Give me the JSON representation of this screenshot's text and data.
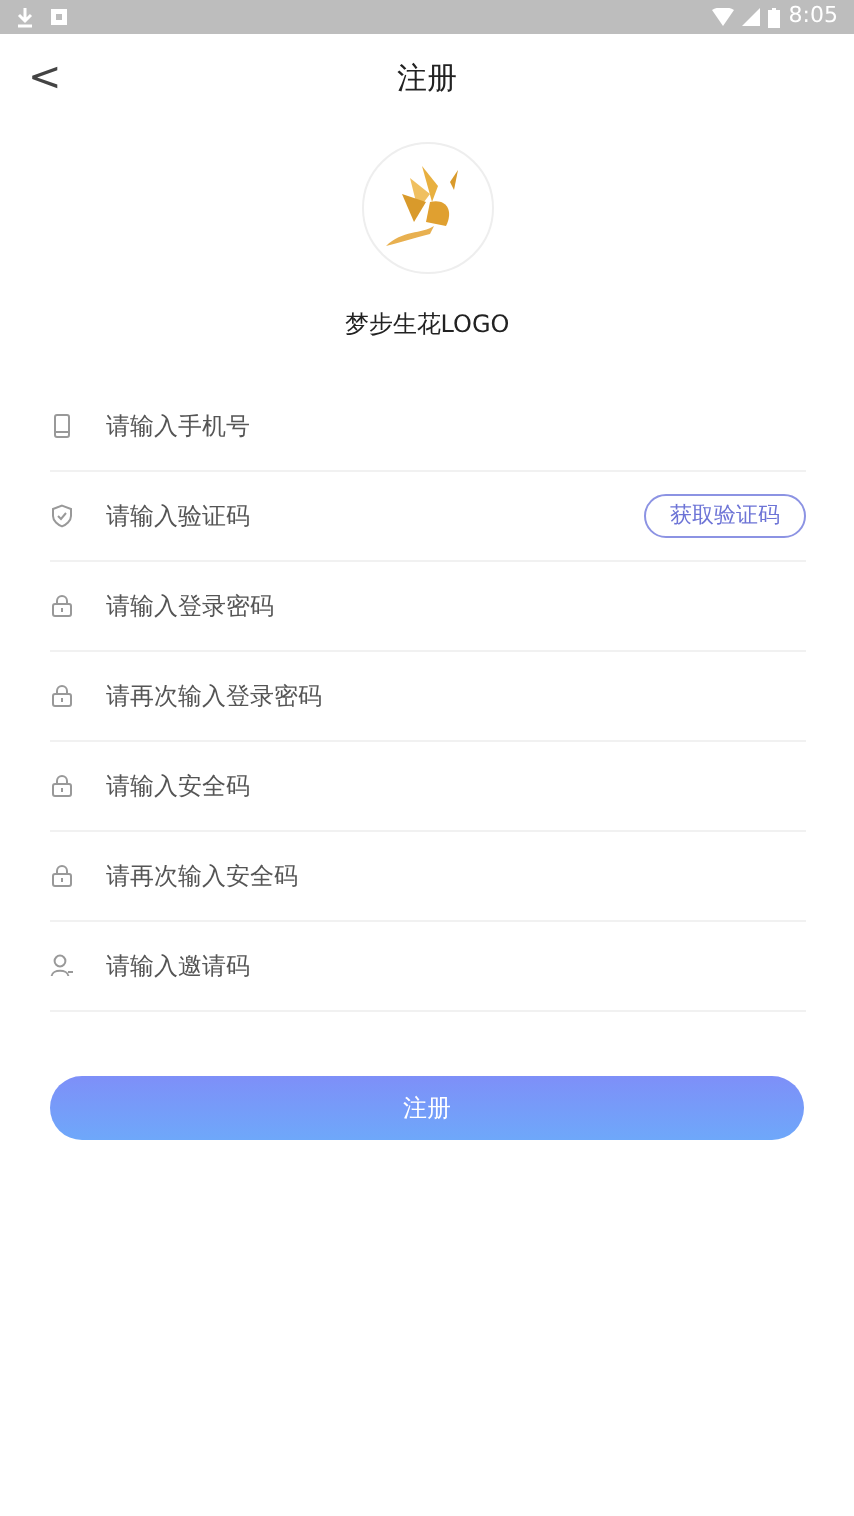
{
  "status_bar": {
    "time": "8:05"
  },
  "header": {
    "back": "<",
    "title": "注册"
  },
  "logo": {
    "kind": "picture",
    "caption": "梦步生花LOGO"
  },
  "fields": [
    {
      "kind": "phone",
      "placeholder": "请输入手机号"
    },
    {
      "kind": "shield",
      "placeholder": "请输入验证码",
      "action": "获取验证码"
    },
    {
      "kind": "lock",
      "placeholder": "请输入登录密码"
    },
    {
      "kind": "lock",
      "placeholder": "请再次输入登录密码"
    },
    {
      "kind": "lock",
      "placeholder": "请输入安全码"
    },
    {
      "kind": "lock",
      "placeholder": "请再次输入安全码"
    },
    {
      "kind": "user",
      "placeholder": "请输入邀请码"
    }
  ],
  "submit": "注册"
}
